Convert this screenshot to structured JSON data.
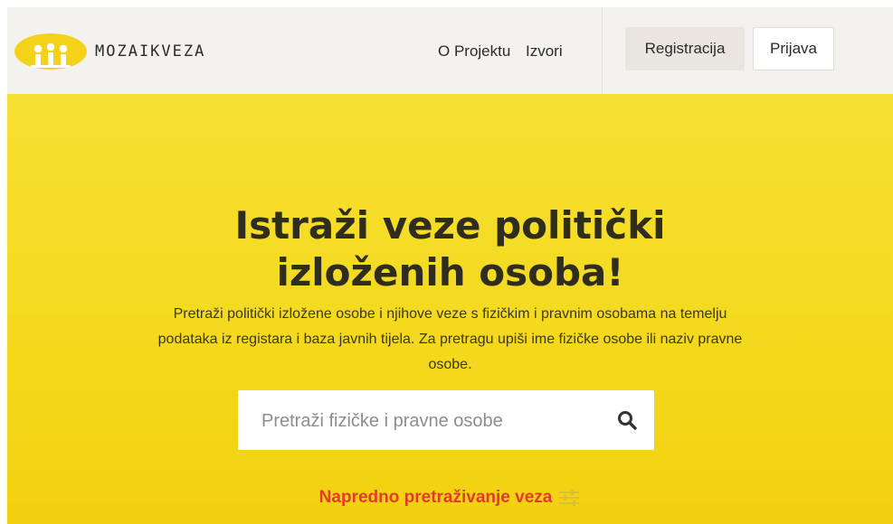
{
  "header": {
    "brand": "MOZAIKVEZA",
    "nav": {
      "projekt": "O Projektu",
      "izvori": "Izvori"
    },
    "register_label": "Registracija",
    "login_label": "Prijava"
  },
  "hero": {
    "title_line1": "Istraži veze politički",
    "title_line2": "izloženih osoba!",
    "description": "Pretraži politički izložene osobe i njihove veze s fizičkim i pravnim osobama na temelju podataka iz registara i baza javnih tijela. Za pretragu upiši ime fizičke osobe ili naziv pravne osobe.",
    "search": {
      "placeholder": "Pretraži fizičke i pravne osobe",
      "value": ""
    },
    "advanced_label": "Napredno pretraživanje veza"
  },
  "icons": {
    "logo": "people-logo-icon",
    "search": "search-icon",
    "advanced": "sliders-icon"
  },
  "colors": {
    "hero_background": "#f4d91e",
    "header_background": "#f4f2ee",
    "accent_red": "#e23b2e",
    "text_dark": "#2f2d1e"
  }
}
